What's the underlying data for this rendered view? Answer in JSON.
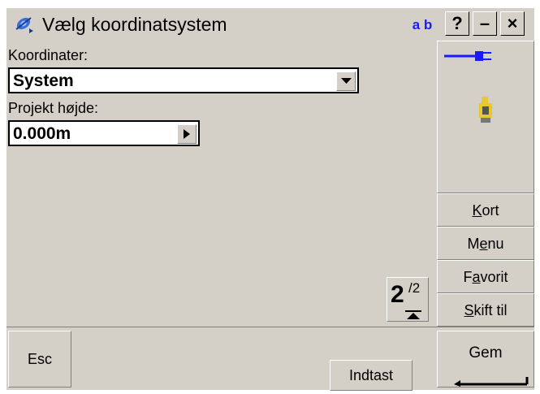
{
  "titlebar": {
    "title": "Vælg koordinatsystem",
    "input_mode": "a b",
    "help": "?",
    "minimize": "–",
    "close": "×"
  },
  "form": {
    "coord_label": "Koordinater:",
    "coord_value": "System",
    "height_label": "Projekt højde:",
    "height_value": "0.000m"
  },
  "pager": {
    "current": "2",
    "total": "/2"
  },
  "sidebar": {
    "buttons": [
      {
        "pre": "",
        "key": "K",
        "post": "ort"
      },
      {
        "pre": "M",
        "key": "e",
        "post": "nu"
      },
      {
        "pre": "F",
        "key": "a",
        "post": "vorit"
      },
      {
        "pre": "",
        "key": "S",
        "post": "kift til"
      }
    ]
  },
  "bottom": {
    "esc": "Esc",
    "indtast": "Indtast",
    "gem": "Gem"
  },
  "colors": {
    "face": "#d4d0c8",
    "accent": "#1a1aff",
    "instrument": "#e8c830"
  }
}
